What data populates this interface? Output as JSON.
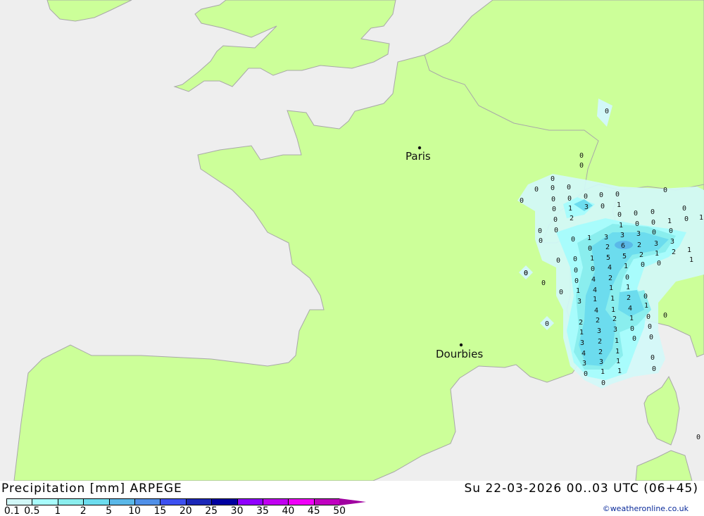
{
  "title": "Precipitation [mm] ARPEGE",
  "datetime": "Su 22-03-2026 00..03 UTC (06+45)",
  "credit": "©weatheronline.co.uk",
  "colors": {
    "sea": "#eeeeee",
    "land": "#ccff99",
    "border": "#a8a8a8"
  },
  "cities": [
    {
      "name": "Paris"
    },
    {
      "name": "Dourbies"
    }
  ],
  "legend": {
    "labels": [
      "0.1",
      "0.5",
      "1",
      "2",
      "5",
      "10",
      "15",
      "20",
      "25",
      "30",
      "35",
      "40",
      "45",
      "50"
    ],
    "colors": [
      "#d2f8f8",
      "#a8fcfc",
      "#8aeeee",
      "#6cdcee",
      "#5ab8e8",
      "#5090e8",
      "#3c50f0",
      "#1c28b8",
      "#0000a0",
      "#9000ff",
      "#c000f0",
      "#f000f8",
      "#c000c0"
    ],
    "arrow_color": "#a000a0"
  },
  "precip_values": [
    "0",
    "0",
    "0",
    "0",
    "0",
    "0",
    "0",
    "0",
    "0",
    "0",
    "0",
    "3",
    "0",
    "1",
    "0",
    "1",
    "0",
    "0",
    "0",
    "0",
    "2",
    "0",
    "1",
    "0",
    "0",
    "1",
    "0",
    "1",
    "0",
    "0",
    "0",
    "0",
    "0",
    "0",
    "1",
    "3",
    "3",
    "3",
    "3",
    "3",
    "0",
    "2",
    "6",
    "2",
    "1",
    "2",
    "1",
    "2",
    "5",
    "5",
    "1",
    "0",
    "0",
    "1",
    "0",
    "0",
    "1",
    "4",
    "0",
    "0",
    "0",
    "2",
    "4",
    "0",
    "0",
    "0",
    "1",
    "1",
    "4",
    "1",
    "0",
    "2",
    "0",
    "3",
    "1",
    "1",
    "4",
    "1",
    "4",
    "1",
    "0",
    "0",
    "1",
    "2",
    "2",
    "2",
    "0",
    "0",
    "0",
    "3",
    "3",
    "1",
    "0",
    "0",
    "1",
    "2",
    "3",
    "1",
    "2",
    "4",
    "0",
    "1",
    "3",
    "3",
    "0",
    "1",
    "1",
    "0",
    "0",
    "0",
    "0",
    "0",
    "0",
    "0"
  ]
}
